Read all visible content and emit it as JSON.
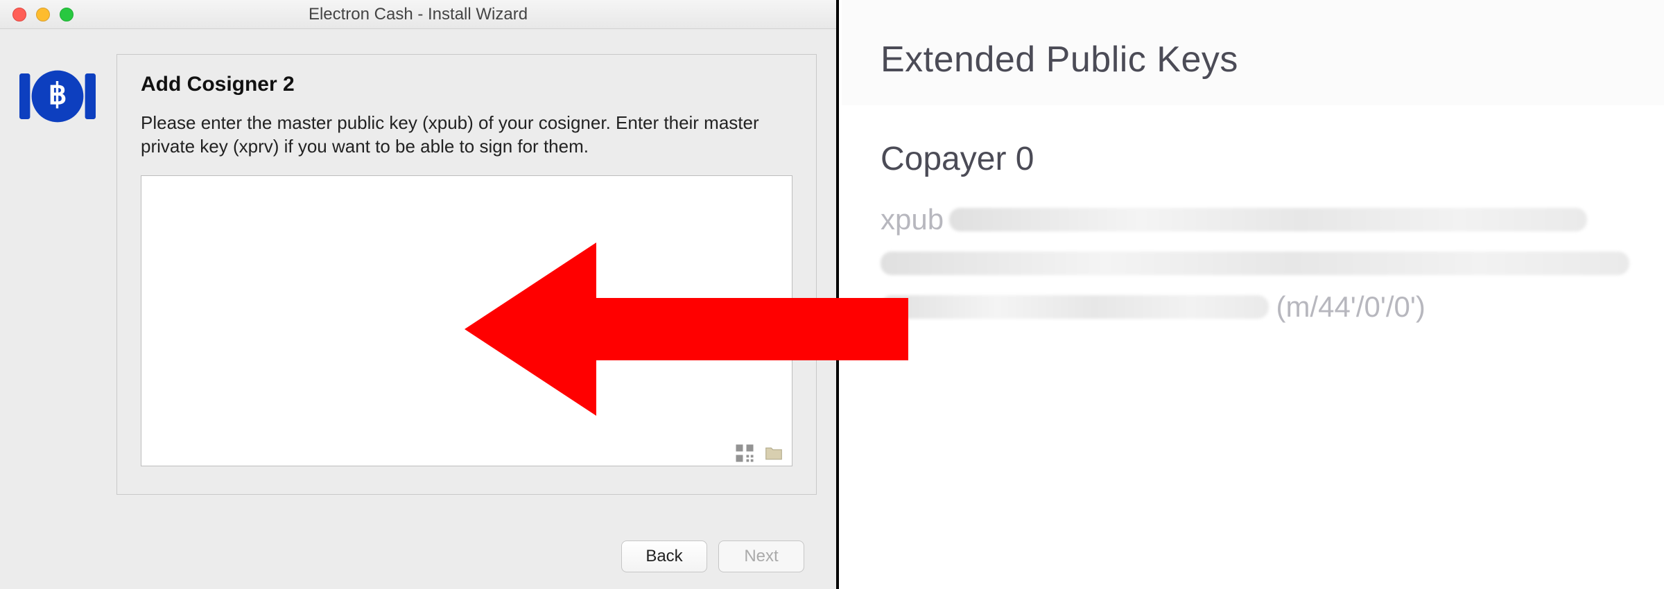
{
  "window": {
    "title": "Electron Cash  -  Install Wizard"
  },
  "wizard": {
    "heading": "Add Cosigner 2",
    "description": "Please enter the master public key (xpub) of your cosigner. Enter their master private key (xprv) if you want to be able to sign for them.",
    "input_value": "",
    "back_label": "Back",
    "next_label": "Next"
  },
  "keys_panel": {
    "section_title": "Extended Public Keys",
    "copayer_label": "Copayer 0",
    "xpub_prefix": "xpub",
    "derivation_path": "(m/44'/0'/0')"
  }
}
